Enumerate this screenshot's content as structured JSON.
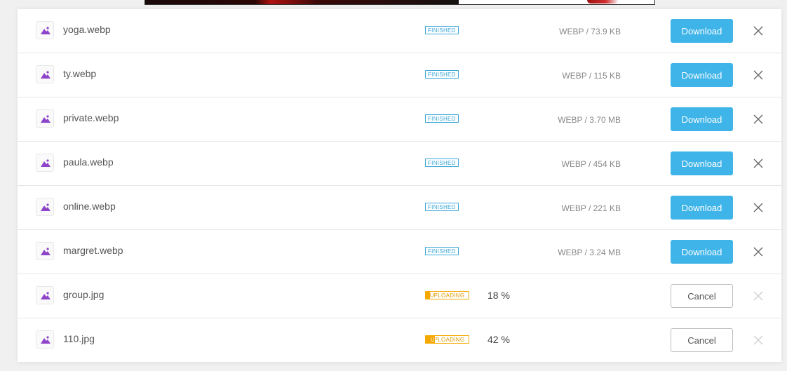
{
  "colors": {
    "accent": "#3fb4e8",
    "finished": "#3aa6d8",
    "uploading": "#f5a800",
    "file_icon": "#8e44c9"
  },
  "icons": {
    "file": "image-icon",
    "remove": "close-icon"
  },
  "files": [
    {
      "name": "yoga.webp",
      "status": "FINISHED",
      "info": "WEBP / 73.9 KB",
      "action": "Download"
    },
    {
      "name": "ty.webp",
      "status": "FINISHED",
      "info": "WEBP / 115 KB",
      "action": "Download"
    },
    {
      "name": "private.webp",
      "status": "FINISHED",
      "info": "WEBP / 3.70 MB",
      "action": "Download"
    },
    {
      "name": "paula.webp",
      "status": "FINISHED",
      "info": "WEBP / 454 KB",
      "action": "Download"
    },
    {
      "name": "online.webp",
      "status": "FINISHED",
      "info": "WEBP / 221 KB",
      "action": "Download"
    },
    {
      "name": "margret.webp",
      "status": "FINISHED",
      "info": "WEBP / 3.24 MB",
      "action": "Download"
    },
    {
      "name": "group.jpg",
      "status": "UPLOADING",
      "progress": 18,
      "progress_label": "18 %",
      "action": "Cancel"
    },
    {
      "name": "110.jpg",
      "status": "UPLOADING",
      "progress": 42,
      "progress_label": "42 %",
      "action": "Cancel"
    }
  ]
}
